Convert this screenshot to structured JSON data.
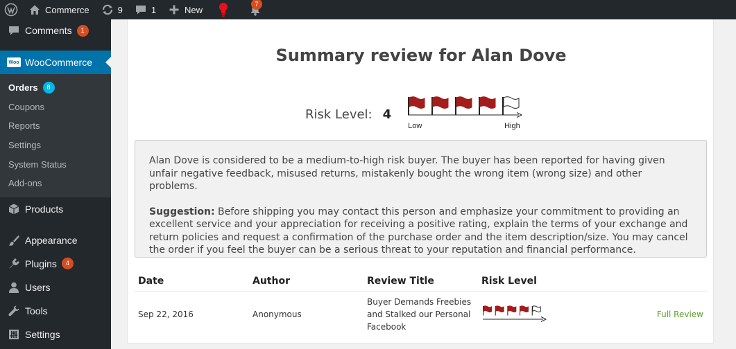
{
  "adminbar": {
    "site_name": "Commerce",
    "updates_count": "9",
    "comments_count": "1",
    "new_label": "New",
    "notifications_count": "7"
  },
  "sidebar": {
    "comments": {
      "label": "Comments",
      "badge": "1"
    },
    "woocommerce": {
      "label": "WooCommerce",
      "icon_text": "Woo"
    },
    "submenu": [
      {
        "label": "Orders",
        "badge": "8"
      },
      {
        "label": "Coupons"
      },
      {
        "label": "Reports"
      },
      {
        "label": "Settings"
      },
      {
        "label": "System Status"
      },
      {
        "label": "Add-ons"
      }
    ],
    "products": {
      "label": "Products"
    },
    "appearance": {
      "label": "Appearance"
    },
    "plugins": {
      "label": "Plugins",
      "badge": "4"
    },
    "users": {
      "label": "Users"
    },
    "tools": {
      "label": "Tools"
    },
    "settings": {
      "label": "Settings"
    }
  },
  "summary": {
    "title": "Summary review for Alan Dove",
    "risk_label": "Risk Level:",
    "risk_value": "4",
    "meter_low": "Low",
    "meter_high": "High",
    "description": "Alan Dove is considered to be a medium-to-high risk buyer. The buyer has been reported for having given unfair negative feedback, misused returns, mistakenly bought the wrong item (wrong size) and other problems.",
    "suggestion_label": "Suggestion:",
    "suggestion_text": " Before shipping you may contact this person and emphasize your commitment to providing an excellent service and your appreciation for receiving a positive rating, explain the terms of your exchange and return policies and request a confirmation of the purchase order and the item description/size. You may cancel the order if you feel the buyer can be a serious threat to your reputation and financial performance."
  },
  "reviews": {
    "headers": [
      "Date",
      "Author",
      "Review Title",
      "Risk Level"
    ],
    "rows": [
      {
        "date": "Sep 22, 2016",
        "author": "Anonymous",
        "title": "Buyer Demands Freebies and Stalked our Personal Facebook",
        "risk_level": 4,
        "link": "Full Review"
      }
    ]
  },
  "colors": {
    "flag_red": "#a51c1c",
    "accent_blue": "#0073aa",
    "link_green": "#5b9e2e",
    "badge_orange": "#d54e21"
  }
}
